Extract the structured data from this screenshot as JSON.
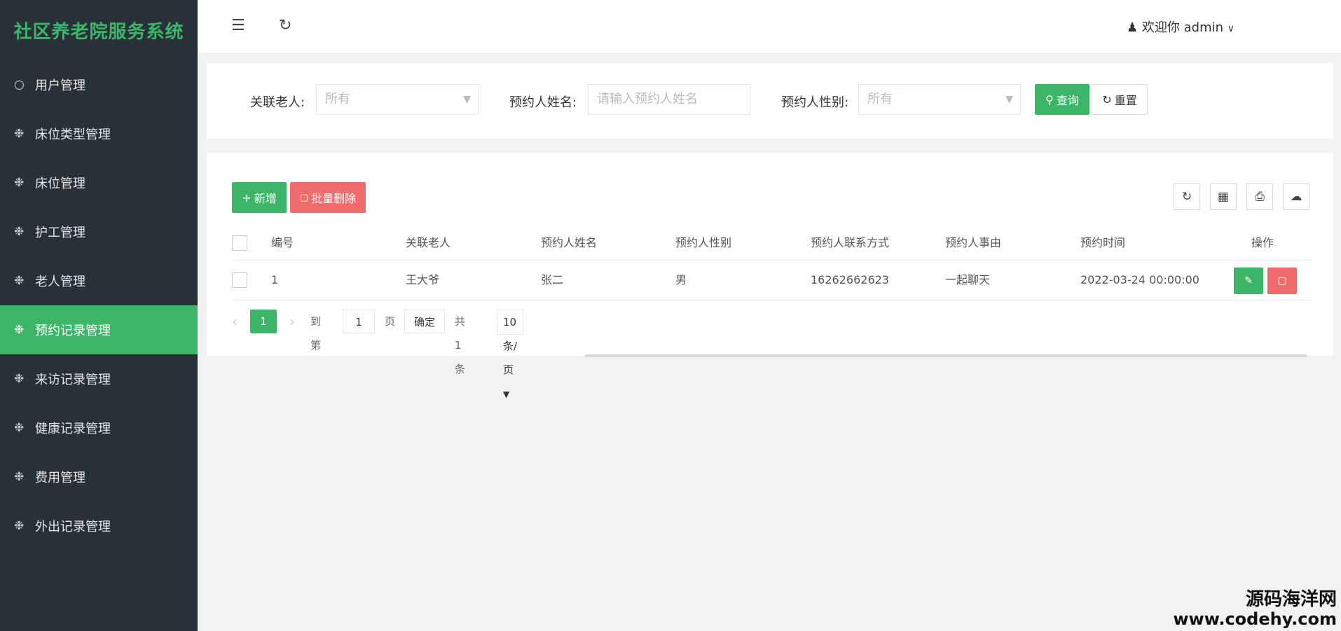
{
  "app": {
    "title": "社区养老院服务系统"
  },
  "sidebar": {
    "items": [
      {
        "label": "用户管理",
        "icon": "user-icon"
      },
      {
        "label": "床位类型管理",
        "icon": "gear-icon"
      },
      {
        "label": "床位管理",
        "icon": "gear-icon"
      },
      {
        "label": "护工管理",
        "icon": "gear-icon"
      },
      {
        "label": "老人管理",
        "icon": "gear-icon"
      },
      {
        "label": "预约记录管理",
        "icon": "gear-icon",
        "active": true
      },
      {
        "label": "来访记录管理",
        "icon": "gear-icon"
      },
      {
        "label": "健康记录管理",
        "icon": "gear-icon"
      },
      {
        "label": "费用管理",
        "icon": "gear-icon"
      },
      {
        "label": "外出记录管理",
        "icon": "gear-icon"
      }
    ]
  },
  "header": {
    "welcome": "欢迎你 admin"
  },
  "filter": {
    "elder_label": "关联老人:",
    "elder_value": "所有",
    "name_label": "预约人姓名:",
    "name_placeholder": "请输入预约人姓名",
    "gender_label": "预约人性别:",
    "gender_value": "所有",
    "search_label": "查询",
    "reset_label": "重置"
  },
  "toolbar": {
    "add_label": "新增",
    "batch_delete_label": "批量删除"
  },
  "table": {
    "columns": [
      "编号",
      "关联老人",
      "预约人姓名",
      "预约人性别",
      "预约人联系方式",
      "预约人事由",
      "预约时间",
      "操作"
    ],
    "rows": [
      [
        "1",
        "王大爷",
        "张二",
        "男",
        "16262662623",
        "一起聊天",
        "2022-03-24 00:00:00"
      ]
    ]
  },
  "pagination": {
    "current_page": "1",
    "goto_prefix": "到第",
    "goto_value": "1",
    "goto_suffix": "页",
    "confirm_label": "确定",
    "total": "共 1 条",
    "page_size": "10 条/页"
  },
  "watermark": {
    "line1": "源码海洋网",
    "line2": "www.codehy.com"
  },
  "colors": {
    "accent": "#3db569",
    "danger": "#f06b6b",
    "sidebar_bg": "#283038"
  }
}
